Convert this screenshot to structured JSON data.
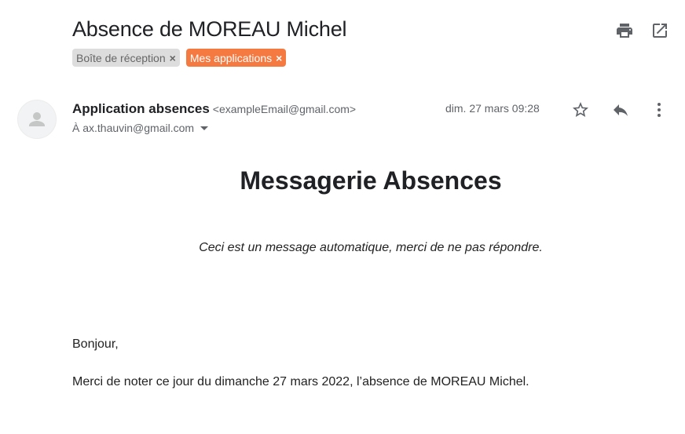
{
  "email": {
    "subject": "Absence de MOREAU Michel",
    "labels": [
      {
        "text": "Boîte de réception",
        "remove": "×",
        "bg": "#dddddd",
        "fg": "#666666"
      },
      {
        "text": "Mes applications",
        "remove": "×",
        "bg": "#f57a41",
        "fg": "#ffffff"
      }
    ],
    "sender": {
      "name": "Application absences",
      "email": "<exampleEmail@gmail.com>"
    },
    "recipient_line": "À ax.thauvin@gmail.com",
    "date": "dim. 27 mars 09:28",
    "body": {
      "heading": "Messagerie Absences",
      "note": "Ceci est un message automatique, merci de ne pas répondre.",
      "greeting": "Bonjour,",
      "message": "Merci de noter ce jour du dimanche 27 mars 2022, l’absence de MOREAU Michel."
    }
  },
  "icons": {
    "print": "print-icon",
    "new_window": "open-in-new-window-icon",
    "star": "star-icon",
    "reply": "reply-icon",
    "more": "more-vert-icon",
    "avatar": "avatar-person-icon",
    "recipient_details": "chevron-down-icon"
  },
  "colors": {
    "icon": "#5f6368",
    "accent_label": "#f57a41"
  }
}
